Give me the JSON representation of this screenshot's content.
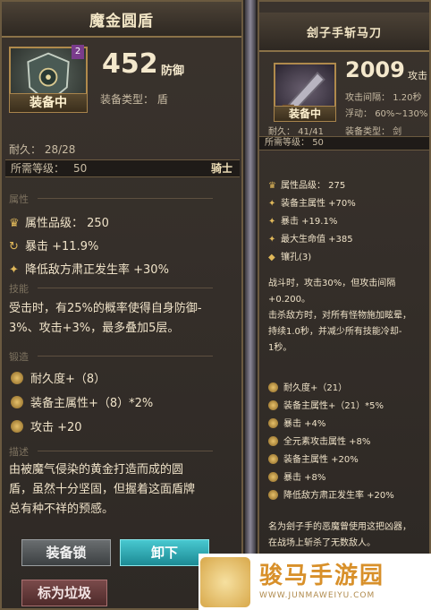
{
  "left": {
    "title": "魔金圆盾",
    "level_badge": "2",
    "value": "452",
    "value_unit": "防御",
    "type_label": "装备类型： 盾",
    "equipped_label": "装备中",
    "durability": "耐久： 28/28",
    "req_label": "所需等级：",
    "req_value": "50",
    "req_class": "骑士",
    "sect_attr": "属性",
    "attrs": [
      {
        "icon": "quality-icon",
        "text": "属性品级： 250"
      },
      {
        "icon": "crit-icon",
        "text": "暴击 +11.9%"
      },
      {
        "icon": "star-icon",
        "text": "降低敌方肃正发生率 +30%"
      }
    ],
    "sect_skill": "技能",
    "skill_desc": [
      "受击时，有25%的概率使得自身防御-",
      "3%、攻击+3%，最多叠加5层。"
    ],
    "sect_refine": "锻造",
    "refines": [
      "耐久度+（8）",
      "装备主属性+（8）*2%",
      "攻击 +20"
    ],
    "sect_lore": "描述",
    "lore": [
      "由被魔气侵染的黄金打造而成的圆",
      "盾，虽然十分坚固，但握着这面盾牌",
      "总有种不祥的预感。"
    ],
    "btn_lock": "装备锁",
    "btn_unequip": "卸下",
    "btn_trash": "标为垃圾"
  },
  "right": {
    "title": "刽子手斩马刀",
    "value": "2009",
    "value_unit": "攻击",
    "interval_label": "攻击间隔：",
    "interval_value": "1.20秒",
    "float_label": "浮动：",
    "float_value": "60%~130%",
    "durability": "耐久： 41/41",
    "type_label": "装备类型： 剑",
    "equipped_label": "装备中",
    "req_label": "所需等级：",
    "req_value": "50",
    "attrs": [
      "属性品级： 275",
      "装备主属性 +70%",
      "暴击 +19.1%",
      "最大生命值 +385",
      "镶孔(3)"
    ],
    "skill_desc": [
      "战斗时，攻击30%，但攻击间隔",
      "+0.200。",
      "击杀敌方时，对所有怪物施加眩晕，",
      "持续1.0秒，并减少所有技能冷却-",
      "1秒。"
    ],
    "refines": [
      "耐久度+（21）",
      "装备主属性+（21）*5%",
      "暴击 +4%",
      "全元素攻击属性 +8%",
      "装备主属性 +20%",
      "暴击 +8%",
      "降低敌方肃正发生率 +20%"
    ],
    "lore": [
      "名为刽子手的恶魔曾使用这把凶器，",
      "在战场上斩杀了无数敌人。"
    ]
  },
  "watermark": {
    "title": "骏马手游园",
    "url": "WWW.JUNMAWEIYU.COM"
  },
  "colors": {
    "accent": "#d8902a",
    "gold": "#e0b85a",
    "unequip": "#1c8a94"
  }
}
